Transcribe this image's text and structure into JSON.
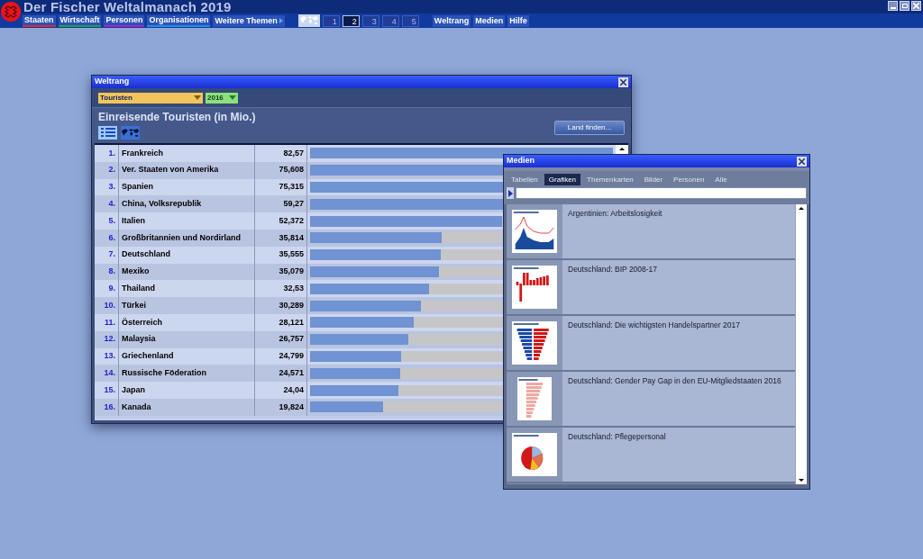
{
  "app": {
    "title": "Der Fischer Weltalmanach 2019"
  },
  "menu": [
    {
      "label": "Staaten",
      "kind": "category",
      "color": "#e02828"
    },
    {
      "label": "Wirtschaft",
      "kind": "category",
      "color": "#20a040"
    },
    {
      "label": "Personen",
      "kind": "category",
      "color": "#b020c0"
    },
    {
      "label": "Organisationen",
      "kind": "category",
      "color": "#2090e0"
    },
    {
      "label": "Weitere Themen",
      "kind": "submenu"
    }
  ],
  "views": [
    {
      "label": "1",
      "selected": false
    },
    {
      "label": "2",
      "selected": true
    },
    {
      "label": "3",
      "selected": false
    },
    {
      "label": "4",
      "selected": false
    },
    {
      "label": "5",
      "selected": false
    }
  ],
  "links": [
    "Weltrang",
    "Medien",
    "Hilfe"
  ],
  "weltrang": {
    "title": "Weltrang",
    "category": "Touristen",
    "year": "2016",
    "heading": "Einreisende Touristen (in Mio.)",
    "view_buttons": [
      {
        "kind": "list",
        "selected": true
      },
      {
        "kind": "map",
        "selected": false
      }
    ],
    "find_button": "Land finden...",
    "rows": [
      {
        "rank": "1.",
        "name": "Frankreich",
        "value": "82,57",
        "level": 1
      },
      {
        "rank": "2.",
        "name": "Ver. Staaten von Amerika",
        "value": "75,608",
        "level": 0.916
      },
      {
        "rank": "3.",
        "name": "Spanien",
        "value": "75,315",
        "level": 0.912
      },
      {
        "rank": "4.",
        "name": "China, Volksrepublik",
        "value": "59,27",
        "level": 0.718
      },
      {
        "rank": "5.",
        "name": "Italien",
        "value": "52,372",
        "level": 0.634
      },
      {
        "rank": "6.",
        "name": "Großbritannien und Nordirland",
        "value": "35,814",
        "level": 0.434
      },
      {
        "rank": "7.",
        "name": "Deutschland",
        "value": "35,555",
        "level": 0.431
      },
      {
        "rank": "8.",
        "name": "Mexiko",
        "value": "35,079",
        "level": 0.425
      },
      {
        "rank": "9.",
        "name": "Thailand",
        "value": "32,53",
        "level": 0.394
      },
      {
        "rank": "10.",
        "name": "Türkei",
        "value": "30,289",
        "level": 0.367
      },
      {
        "rank": "11.",
        "name": "Österreich",
        "value": "28,121",
        "level": 0.341
      },
      {
        "rank": "12.",
        "name": "Malaysia",
        "value": "26,757",
        "level": 0.324
      },
      {
        "rank": "13.",
        "name": "Griechenland",
        "value": "24,799",
        "level": 0.3
      },
      {
        "rank": "14.",
        "name": "Russische Föderation",
        "value": "24,571",
        "level": 0.298
      },
      {
        "rank": "15.",
        "name": "Japan",
        "value": "24,04",
        "level": 0.291
      },
      {
        "rank": "16.",
        "name": "Kanada",
        "value": "19,824",
        "level": 0.24
      }
    ]
  },
  "medien": {
    "title": "Medien",
    "tabs": [
      {
        "label": "Tabellen",
        "selected": false
      },
      {
        "label": "Grafiken",
        "selected": true
      },
      {
        "label": "Themenkarten",
        "selected": false
      },
      {
        "label": "Bilder",
        "selected": false
      },
      {
        "label": "Personen",
        "selected": false
      },
      {
        "label": "Alle",
        "selected": false
      }
    ],
    "items": [
      {
        "title": "Argentinien: Arbeitslosigkeit",
        "kind": "line"
      },
      {
        "title": "Deutschland: BIP 2008-17",
        "kind": "bar"
      },
      {
        "title": "Deutschland: Die wichtigsten Handelspartner 2017",
        "kind": "butterfly"
      },
      {
        "title": "Deutschland: Gender Pay Gap in den EU-Mitgliedstaaten 2016",
        "kind": "hbar"
      },
      {
        "title": "Deutschland: Pflegepersonal",
        "kind": "pie"
      }
    ]
  }
}
